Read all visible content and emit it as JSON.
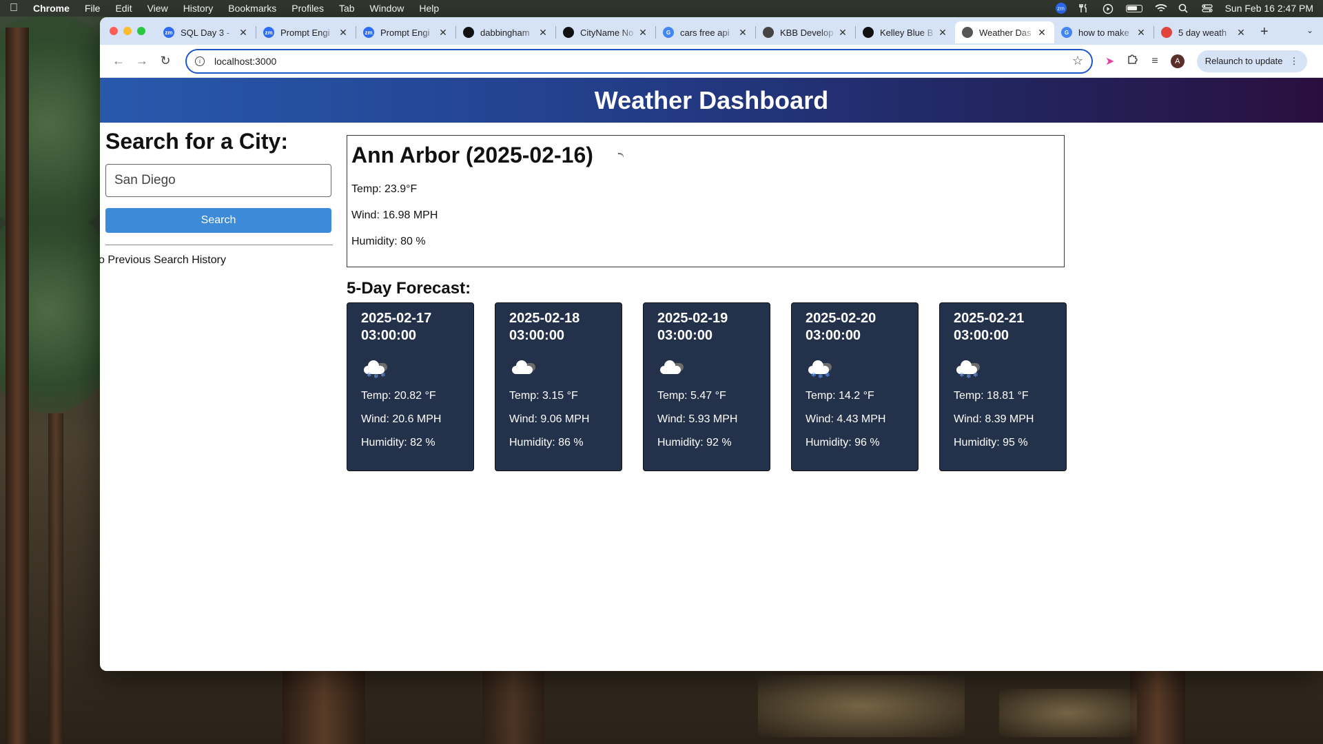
{
  "menubar": {
    "app_name": "Chrome",
    "items": [
      "File",
      "Edit",
      "View",
      "History",
      "Bookmarks",
      "Profiles",
      "Tab",
      "Window",
      "Help"
    ],
    "zoom_badge": "zm",
    "datetime": "Sun Feb 16  2:47 PM"
  },
  "tabs": [
    {
      "title": "SQL Day 3 -",
      "favicon": "zm",
      "color": "#2d6cf5",
      "active": false
    },
    {
      "title": "Prompt Engi",
      "favicon": "zm",
      "color": "#2d6cf5",
      "active": false
    },
    {
      "title": "Prompt Engi",
      "favicon": "zm",
      "color": "#2d6cf5",
      "active": false
    },
    {
      "title": "dabbingham",
      "favicon": "github-icon",
      "color": "#111111",
      "active": false
    },
    {
      "title": "CityName No",
      "favicon": "openai-icon",
      "color": "#111111",
      "active": false
    },
    {
      "title": "cars free api",
      "favicon": "G",
      "color": "#4285f4",
      "active": false
    },
    {
      "title": "KBB Develop",
      "favicon": "kbb-icon",
      "color": "#444444",
      "active": false
    },
    {
      "title": "Kelley Blue B",
      "favicon": "code-icon",
      "color": "#111111",
      "active": false
    },
    {
      "title": "Weather Das",
      "favicon": "globe-icon",
      "color": "#555555",
      "active": true
    },
    {
      "title": "how to make",
      "favicon": "G",
      "color": "#4285f4",
      "active": false
    },
    {
      "title": "5 day weath",
      "favicon": "red-icon",
      "color": "#e0443a",
      "active": false
    }
  ],
  "toolbar": {
    "url": "localhost:3000",
    "avatar_letter": "A",
    "relaunch_label": "Relaunch to update"
  },
  "page": {
    "header": "Weather Dashboard",
    "search_heading": "Search for a City:",
    "search_value": "San Diego",
    "search_button": "Search",
    "history_label": "Previous Search History",
    "today": {
      "title": "Ann Arbor (2025-02-16)",
      "temp": "Temp: 23.9°F",
      "wind": "Wind: 16.98 MPH",
      "humidity": "Humidity: 80 %"
    },
    "forecast_title": "5-Day Forecast:",
    "forecast": [
      {
        "date": "2025-02-17\n03:00:00",
        "icon": "snow-cloud-icon",
        "temp": "Temp: 20.82 °F",
        "wind": "Wind: 20.6 MPH",
        "humidity": "Humidity: 82 %"
      },
      {
        "date": "2025-02-18\n03:00:00",
        "icon": "cloud-icon",
        "temp": "Temp: 3.15 °F",
        "wind": "Wind: 9.06 MPH",
        "humidity": "Humidity: 86 %"
      },
      {
        "date": "2025-02-19\n03:00:00",
        "icon": "cloud-icon",
        "temp": "Temp: 5.47 °F",
        "wind": "Wind: 5.93 MPH",
        "humidity": "Humidity: 92 %"
      },
      {
        "date": "2025-02-20\n03:00:00",
        "icon": "snow-cloud-icon",
        "temp": "Temp: 14.2 °F",
        "wind": "Wind: 4.43 MPH",
        "humidity": "Humidity: 96 %"
      },
      {
        "date": "2025-02-21\n03:00:00",
        "icon": "snow-cloud-icon",
        "temp": "Temp: 18.81 °F",
        "wind": "Wind: 8.39 MPH",
        "humidity": "Humidity: 95 %"
      }
    ]
  }
}
